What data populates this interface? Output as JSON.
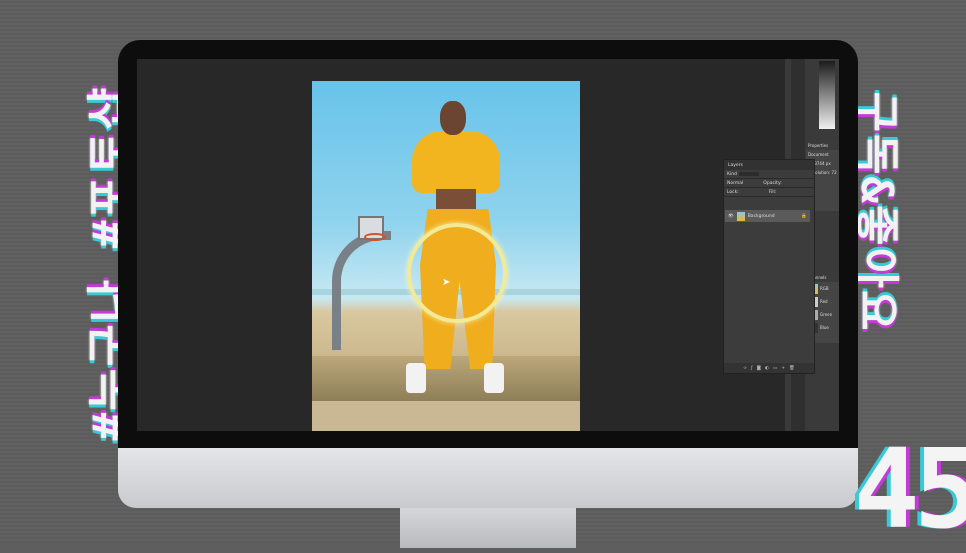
{
  "overlay": {
    "left_text": "#누구나 #포토샵",
    "right_text": "구독&좋아요",
    "episode_number": "45"
  },
  "photoshop": {
    "properties_title": "Properties",
    "properties_doc": "Document",
    "properties_w": "W: 3744 px",
    "properties_res": "Resolution: 72 px",
    "layers_title": "Layers",
    "layers_kind": "Kind",
    "layers_mode": "Normal",
    "layers_opacity": "Opacity:",
    "layers_lock": "Lock:",
    "layers_fill": "Fill:",
    "layer_name": "Background",
    "channels_title": "Channels",
    "channels": [
      "RGB",
      "Red",
      "Green",
      "Blue"
    ]
  }
}
